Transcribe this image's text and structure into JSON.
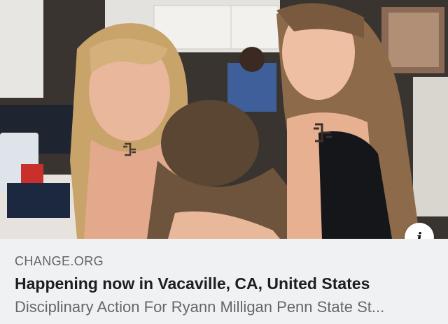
{
  "link_preview": {
    "domain": "CHANGE.ORG",
    "headline": "Happening now in Vacaville, CA, United States",
    "description": "Disciplinary Action For Ryann Milligan Penn State St...",
    "info_button_glyph": "i",
    "info_icon": "info-icon"
  },
  "colors": {
    "meta_background": "#f0f1f3",
    "domain_text": "#5f6368",
    "headline_text": "#1c1e21",
    "description_text": "#65676b"
  }
}
